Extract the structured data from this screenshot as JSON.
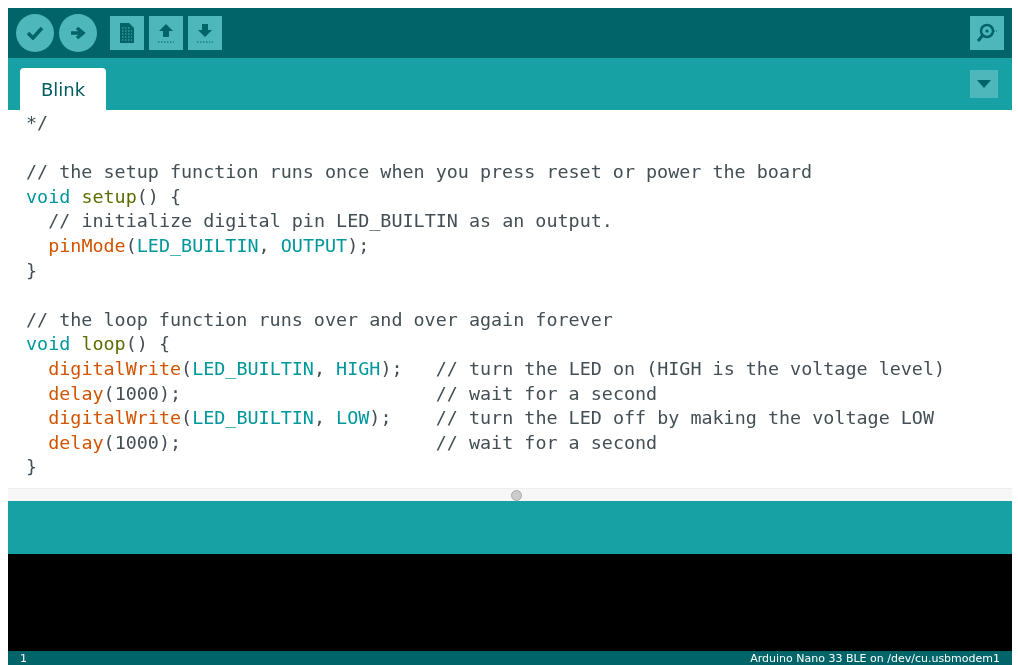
{
  "toolbar": {
    "buttons": [
      {
        "kind": "verify"
      },
      {
        "kind": "upload"
      },
      {
        "kind": "new"
      },
      {
        "kind": "open"
      },
      {
        "kind": "save"
      }
    ],
    "monitor": {
      "kind": "monitor"
    }
  },
  "tabs": [
    {
      "label": "Blink",
      "selected": true
    }
  ],
  "editor": {
    "lines": [
      {
        "kind": "code",
        "indent": false,
        "segments": [
          {
            "kind": "comment",
            "text": "*/"
          }
        ]
      },
      {
        "kind": "blank"
      },
      {
        "kind": "code",
        "indent": false,
        "segments": [
          {
            "kind": "comment",
            "text": "// the setup function runs once when you press reset or power the board"
          }
        ]
      },
      {
        "kind": "code",
        "indent": false,
        "segments": [
          {
            "kind": "keyword",
            "text": "void "
          },
          {
            "kind": "function",
            "text": "setup"
          },
          {
            "kind": "plain",
            "text": "() {"
          }
        ]
      },
      {
        "kind": "code",
        "indent": true,
        "segments": [
          {
            "kind": "comment",
            "text": "// initialize digital pin LED_BUILTIN as an output."
          }
        ]
      },
      {
        "kind": "code",
        "indent": true,
        "segments": [
          {
            "kind": "builtin",
            "text": "pinMode"
          },
          {
            "kind": "plain",
            "text": "("
          },
          {
            "kind": "constant",
            "text": "LED_BUILTIN"
          },
          {
            "kind": "plain",
            "text": ", "
          },
          {
            "kind": "constant",
            "text": "OUTPUT"
          },
          {
            "kind": "plain",
            "text": ");"
          }
        ]
      },
      {
        "kind": "code",
        "indent": false,
        "segments": [
          {
            "kind": "plain",
            "text": "}"
          }
        ]
      },
      {
        "kind": "blank"
      },
      {
        "kind": "code",
        "indent": false,
        "segments": [
          {
            "kind": "comment",
            "text": "// the loop function runs over and over again forever"
          }
        ]
      },
      {
        "kind": "code",
        "indent": false,
        "segments": [
          {
            "kind": "keyword",
            "text": "void "
          },
          {
            "kind": "function",
            "text": "loop"
          },
          {
            "kind": "plain",
            "text": "() {"
          }
        ]
      },
      {
        "kind": "code",
        "indent": true,
        "segments": [
          {
            "kind": "builtin",
            "text": "digitalWrite"
          },
          {
            "kind": "plain",
            "text": "("
          },
          {
            "kind": "constant",
            "text": "LED_BUILTIN"
          },
          {
            "kind": "plain",
            "text": ", "
          },
          {
            "kind": "constant",
            "text": "HIGH"
          },
          {
            "kind": "plain",
            "text": ");   "
          },
          {
            "kind": "comment",
            "text": "// turn the LED on (HIGH is the voltage level)"
          }
        ]
      },
      {
        "kind": "code",
        "indent": true,
        "segments": [
          {
            "kind": "builtin",
            "text": "delay"
          },
          {
            "kind": "plain",
            "text": "(1000);                       "
          },
          {
            "kind": "comment",
            "text": "// wait for a second"
          }
        ]
      },
      {
        "kind": "code",
        "indent": true,
        "segments": [
          {
            "kind": "builtin",
            "text": "digitalWrite"
          },
          {
            "kind": "plain",
            "text": "("
          },
          {
            "kind": "constant",
            "text": "LED_BUILTIN"
          },
          {
            "kind": "plain",
            "text": ", "
          },
          {
            "kind": "constant",
            "text": "LOW"
          },
          {
            "kind": "plain",
            "text": ");    "
          },
          {
            "kind": "comment",
            "text": "// turn the LED off by making the voltage LOW"
          }
        ]
      },
      {
        "kind": "code",
        "indent": true,
        "segments": [
          {
            "kind": "builtin",
            "text": "delay"
          },
          {
            "kind": "plain",
            "text": "(1000);                       "
          },
          {
            "kind": "comment",
            "text": "// wait for a second"
          }
        ]
      },
      {
        "kind": "code",
        "indent": false,
        "segments": [
          {
            "kind": "plain",
            "text": "}"
          }
        ]
      }
    ]
  },
  "status_bar": {
    "line": "1",
    "board": "Arduino Nano 33 BLE on /dev/cu.usbmodem1"
  }
}
